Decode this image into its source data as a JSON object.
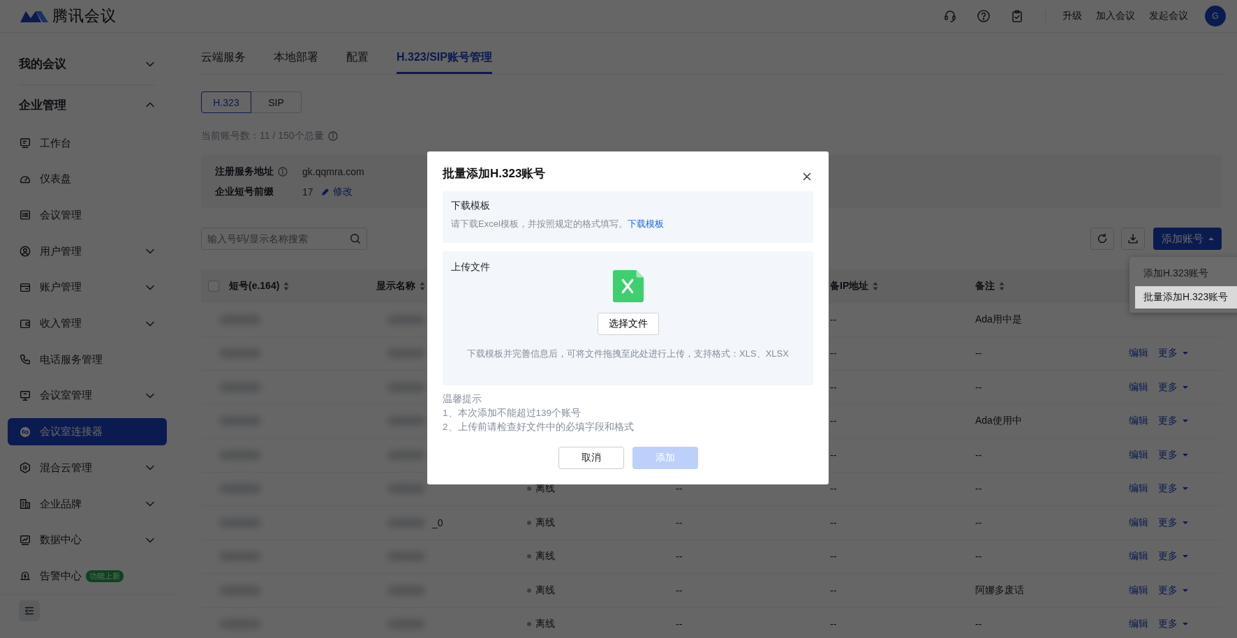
{
  "header": {
    "logo": "腾讯会议",
    "links": [
      "升级",
      "加入会议",
      "发起会议"
    ],
    "avatar": "G"
  },
  "sidebar": {
    "sections": [
      {
        "label": "我的会议",
        "expanded": false
      },
      {
        "label": "企业管理",
        "expanded": true,
        "children": [
          {
            "label": "工作台",
            "kind": "link",
            "selected": false
          },
          {
            "label": "仪表盘",
            "kind": "link",
            "selected": false
          },
          {
            "label": "会议管理",
            "kind": "link",
            "selected": false
          },
          {
            "label": "用户管理",
            "kind": "group",
            "selected": false
          },
          {
            "label": "账户管理",
            "kind": "group",
            "selected": false
          },
          {
            "label": "收入管理",
            "kind": "group",
            "selected": false
          },
          {
            "label": "电话服务管理",
            "kind": "link",
            "selected": false
          },
          {
            "label": "会议室管理",
            "kind": "group",
            "selected": false
          },
          {
            "label": "会议室连接器",
            "kind": "link",
            "selected": true
          },
          {
            "label": "混合云管理",
            "kind": "group",
            "selected": false
          },
          {
            "label": "企业品牌",
            "kind": "group",
            "selected": false
          },
          {
            "label": "数据中心",
            "kind": "group",
            "selected": false
          },
          {
            "label": "告警中心",
            "kind": "link",
            "selected": false,
            "badge": "功能上新"
          }
        ]
      }
    ]
  },
  "tabs": [
    {
      "label": "云端服务",
      "selected": false
    },
    {
      "label": "本地部署",
      "selected": false
    },
    {
      "label": "配置",
      "selected": false
    },
    {
      "label": "H.323/SIP账号管理",
      "selected": true
    }
  ],
  "protocol_switch": [
    {
      "label": "H.323",
      "selected": true
    },
    {
      "label": "SIP",
      "selected": false
    }
  ],
  "account_count": "当前账号数：11 / 150个总量",
  "server_info": [
    {
      "label": "注册服务地址",
      "value": "gk.qqmra.com",
      "kind": "info"
    },
    {
      "label": "企业短号前缀",
      "value": "17",
      "kind": "editable",
      "action": "修改"
    }
  ],
  "search": {
    "placeholder": "输入号码/显示名称搜索"
  },
  "add_button": {
    "label": "添加账号",
    "expanded": true
  },
  "add_menu": [
    {
      "label": "添加H.323账号",
      "selected": false
    },
    {
      "label": "批量添加H.323账号",
      "selected": true
    }
  ],
  "table": {
    "select_all_checked": false,
    "header": {
      "column_1": "短号(e.164)",
      "column_2": "显示名称",
      "column_5": "备IP地址",
      "column_6": "备注"
    },
    "rows": [
      {
        "blurred": true,
        "column_5": "--",
        "column_6": "Ada用中是"
      },
      {
        "blurred": true,
        "column_5": "--",
        "column_6": "--",
        "actions": [
          "编辑",
          "更多"
        ]
      },
      {
        "blurred": true,
        "column_5": "--",
        "column_6": "--",
        "actions": [
          "编辑",
          "更多"
        ]
      },
      {
        "blurred": true,
        "column_5": "--",
        "column_6": "Ada使用中",
        "actions": [
          "编辑",
          "更多"
        ]
      },
      {
        "blurred": true,
        "column_5": "--",
        "column_6": "--",
        "actions": [
          "编辑",
          "更多"
        ]
      },
      {
        "blurred": true,
        "column_3": "离线",
        "column_4": "--",
        "column_5": "--",
        "column_6": "--",
        "actions": [
          "编辑",
          "更多"
        ]
      },
      {
        "blurred": true,
        "column_2": "_0",
        "column_3": "离线",
        "column_4": "--",
        "column_5": "--",
        "column_6": "--",
        "actions": [
          "编辑",
          "更多"
        ]
      },
      {
        "blurred": true,
        "column_3": "离线",
        "column_4": "--",
        "column_5": "--",
        "column_6": "--",
        "actions": [
          "编辑",
          "更多"
        ]
      },
      {
        "blurred": true,
        "column_3": "离线",
        "column_4": "--",
        "column_5": "--",
        "column_6": "阿娜多废话",
        "actions": [
          "编辑",
          "更多"
        ]
      },
      {
        "blurred": true,
        "column_3": "离线",
        "column_4": "--",
        "column_5": "--",
        "column_6": "--",
        "actions": [
          "编辑",
          "更多"
        ]
      }
    ]
  },
  "dialog": {
    "title": "批量添加H.323账号",
    "download": {
      "title": "下载模板",
      "text": "请下载Excel模板，并按照规定的格式填写。",
      "link": "下载模板"
    },
    "upload": {
      "title": "上传文件",
      "button": "选择文件",
      "hint": "下载模板并完善信息后，可将文件拖拽至此处进行上传，支持格式：XLS、XLSX"
    },
    "tips": {
      "title": "温馨提示",
      "lines": [
        "1、本次添加不能超过139个账号",
        "2、上传前请检查好文件中的必填字段和格式"
      ]
    },
    "buttons": [
      {
        "label": "取消",
        "kind": "default",
        "disabled": false
      },
      {
        "label": "添加",
        "kind": "primary",
        "disabled": true
      }
    ]
  }
}
